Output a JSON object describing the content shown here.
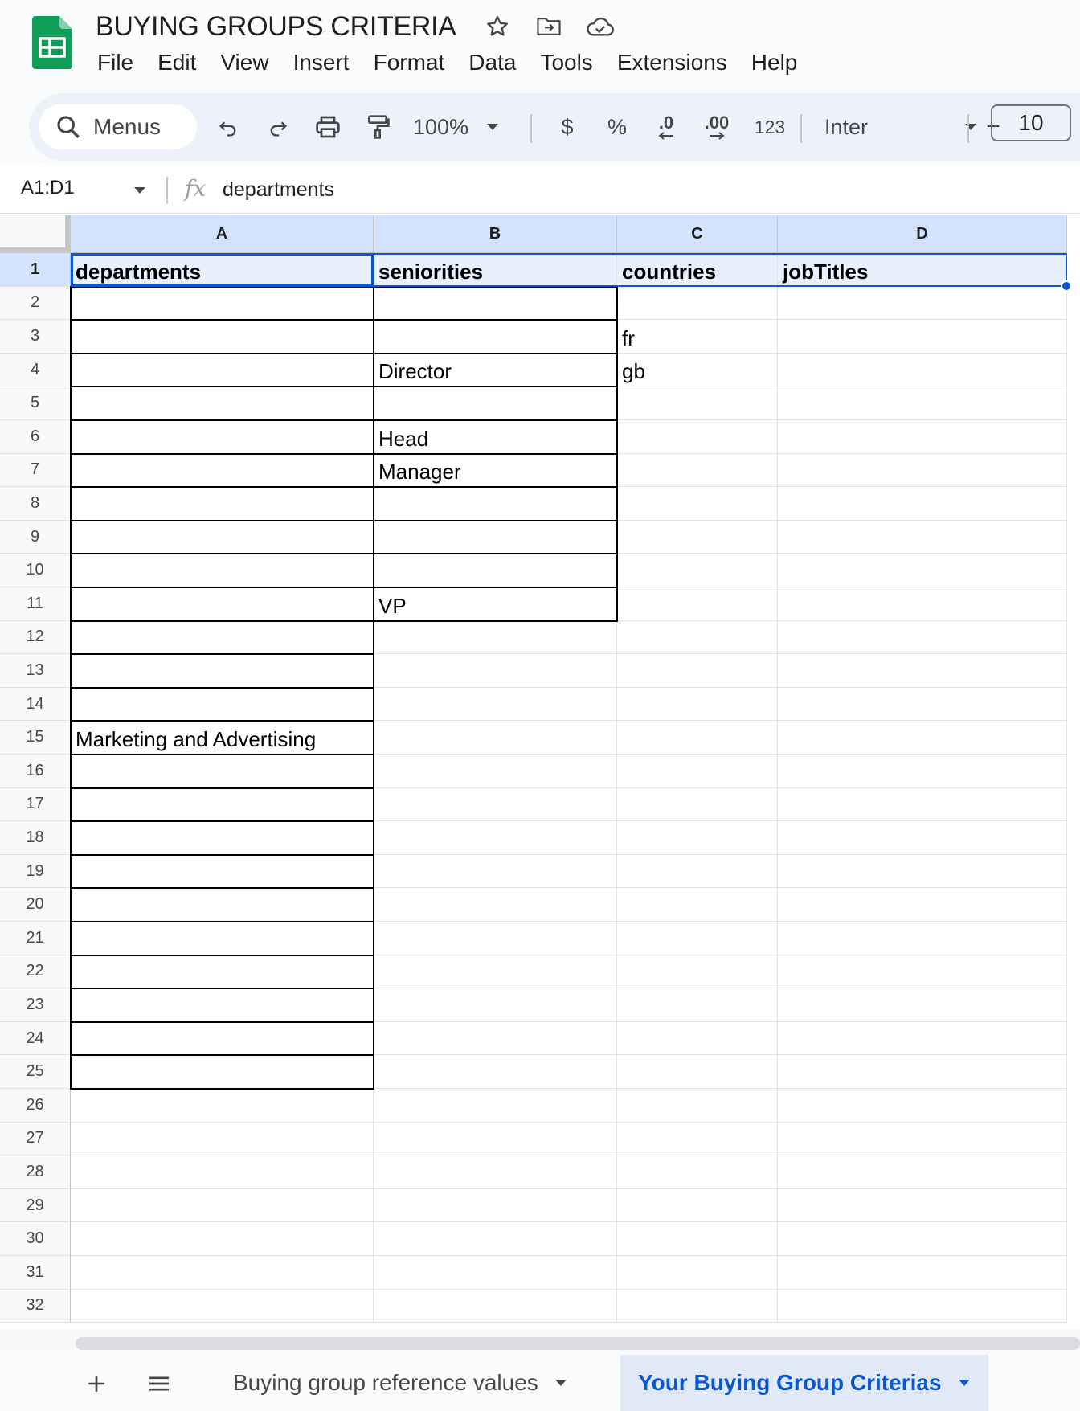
{
  "app": {
    "title": "BUYING GROUPS CRITERIA",
    "menus": [
      "File",
      "Edit",
      "View",
      "Insert",
      "Format",
      "Data",
      "Tools",
      "Extensions",
      "Help"
    ]
  },
  "toolbar": {
    "search_label": "Menus",
    "zoom": "100%",
    "currency": "$",
    "percent": "%",
    "decrease_decimal": ".0",
    "increase_decimal": ".00",
    "number_format": "123",
    "font": "Inter",
    "font_size_minus": "−",
    "font_size": "10"
  },
  "formula_bar": {
    "name_box": "A1:D1",
    "fx": "fx",
    "formula": "departments"
  },
  "grid": {
    "columns": [
      "A",
      "B",
      "C",
      "D"
    ],
    "rows": [
      "1",
      "2",
      "3",
      "4",
      "5",
      "6",
      "7",
      "8",
      "9",
      "10",
      "11",
      "12",
      "13",
      "14",
      "15",
      "16",
      "17",
      "18",
      "19",
      "20",
      "21",
      "22",
      "23",
      "24",
      "25",
      "26",
      "27",
      "28",
      "29",
      "30",
      "31",
      "32"
    ],
    "cells": {
      "A1": "departments",
      "B1": "seniorities",
      "C1": "countries",
      "D1": "jobTitles",
      "C3": "fr",
      "C4": "gb",
      "B4": "Director",
      "B6": "Head",
      "B7": "Manager",
      "B11": "VP",
      "A15": "Marketing and Advertising"
    }
  },
  "sheets": {
    "tabs": [
      {
        "label": "Buying group reference values",
        "active": false
      },
      {
        "label": "Your Buying Group Criterias",
        "active": true
      }
    ]
  },
  "colors": {
    "accent": "#0b57d0",
    "header_selected": "#d3e3fd",
    "logo": "#0f9d58"
  }
}
